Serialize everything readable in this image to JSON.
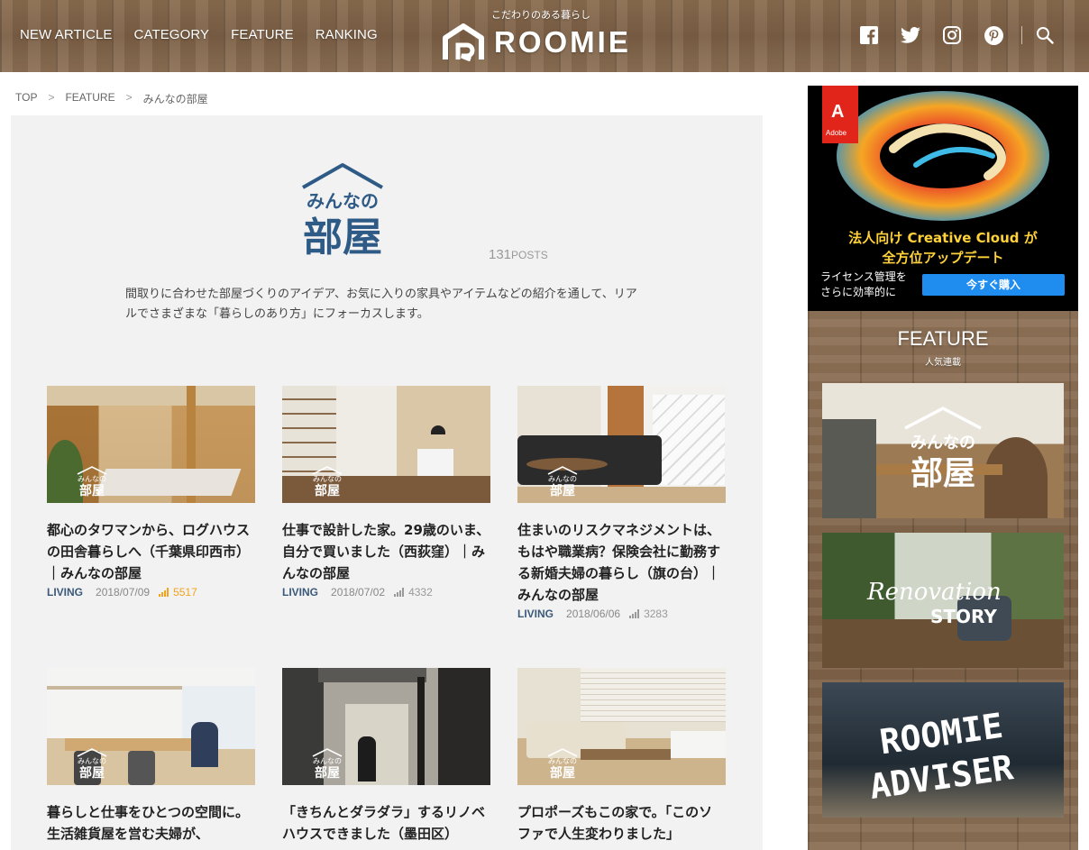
{
  "header": {
    "nav": [
      "NEW ARTICLE",
      "CATEGORY",
      "FEATURE",
      "RANKING"
    ],
    "tagline": "こだわりのある暮らし",
    "logo_text": "ROOMIE",
    "social_icons": [
      "facebook-icon",
      "twitter-icon",
      "instagram-icon",
      "pinterest-icon",
      "search-icon"
    ]
  },
  "breadcrumb": [
    "TOP",
    "FEATURE",
    "みんなの部屋"
  ],
  "breadcrumb_sep": ">",
  "category": {
    "logo_line1": "みんなの",
    "logo_line2": "部屋",
    "post_count": "131",
    "post_label": "POSTS",
    "description": "間取りに合わせた部屋づくりのアイデア、お気に入りの家具やアイテムなどの紹介を通して、リアルでさまざまな「暮らしのあり方」にフォーカスします。"
  },
  "watermark": {
    "line1": "みんなの",
    "line2": "部屋"
  },
  "articles": [
    {
      "title": "都心のタワマンから、ログハウスの田舎暮らしへ（千葉県印西市）｜みんなの部屋",
      "category": "LIVING",
      "date": "2018/07/09",
      "views": "5517",
      "hot": true
    },
    {
      "title": "仕事で設計した家。29歳のいま、自分で買いました（西荻窪）｜みんなの部屋",
      "category": "LIVING",
      "date": "2018/07/02",
      "views": "4332",
      "hot": false
    },
    {
      "title": "住まいのリスクマネジメントは、もはや職業病？保険会社に勤務する新婚夫婦の暮らし（旗の台）｜みんなの部屋",
      "category": "LIVING",
      "date": "2018/06/06",
      "views": "3283",
      "hot": false
    },
    {
      "title": "暮らしと仕事をひとつの空間に。生活雑貨屋を営む夫婦が、",
      "category": "",
      "date": "",
      "views": "",
      "hot": false
    },
    {
      "title": "「きちんとダラダラ」するリノベハウスできました（墨田区）",
      "category": "",
      "date": "",
      "views": "",
      "hot": false
    },
    {
      "title": "プロポーズもこの家で。「このソファで人生変わりました」",
      "category": "",
      "date": "",
      "views": "",
      "hot": false
    }
  ],
  "ad": {
    "brand": "Adobe",
    "brand_mark": "A",
    "headline_line1": "法人向け Creative Cloud が",
    "headline_line2": "全方位アップデート",
    "sub_line1": "ライセンス管理を",
    "sub_line2": "さらに効率的に",
    "button": "今すぐ購入"
  },
  "sidebar": {
    "feature_title": "FEATURE",
    "feature_sub": "人気連載",
    "banners": [
      {
        "line1": "みんなの",
        "line2": "部屋"
      },
      {
        "line1": "Renovation",
        "line2": "STORY"
      },
      {
        "line1": "ROOMIE",
        "line2": "ADVISER"
      }
    ]
  },
  "colors": {
    "brand_blue": "#2e5a86",
    "category_blue": "#3b5a7a",
    "hot_views": "#f2a31b",
    "ad_yellow": "#ffd23a",
    "ad_button": "#1f8cf0"
  }
}
